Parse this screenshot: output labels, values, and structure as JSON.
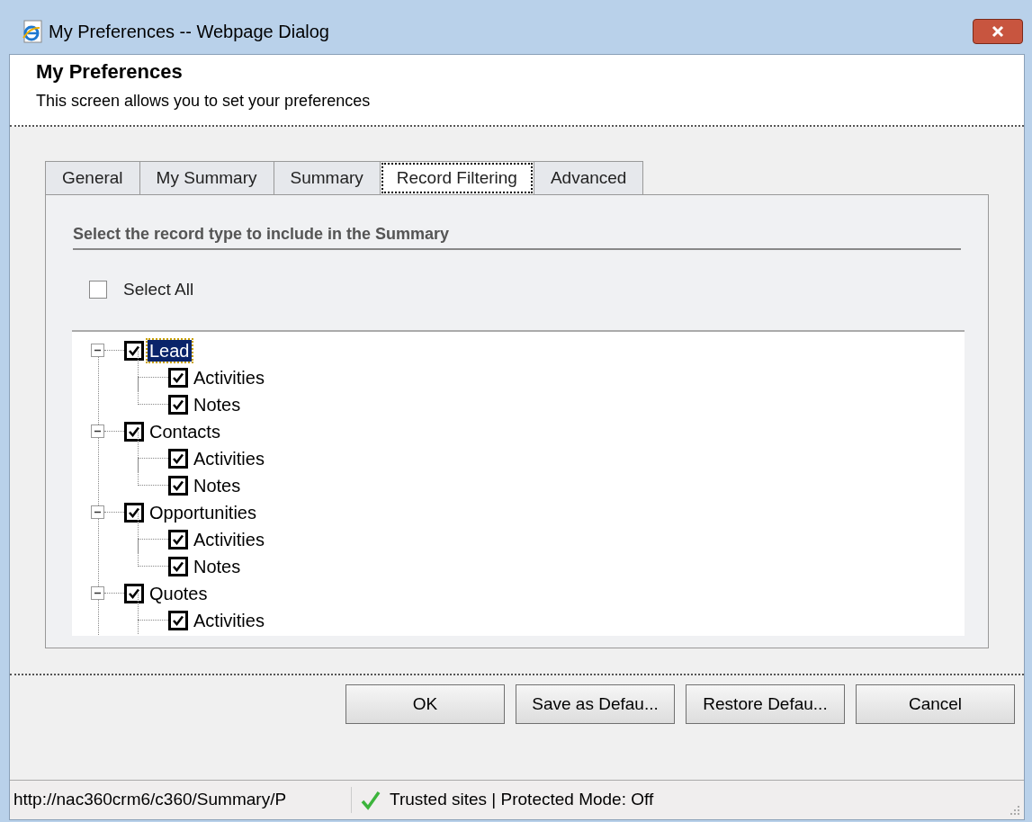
{
  "window": {
    "title": "My Preferences -- Webpage Dialog"
  },
  "header": {
    "title": "My Preferences",
    "subtitle": "This screen allows you to set your preferences"
  },
  "tabs": [
    {
      "label": "General",
      "selected": false
    },
    {
      "label": "My Summary",
      "selected": false
    },
    {
      "label": "Summary",
      "selected": false
    },
    {
      "label": "Record Filtering",
      "selected": true
    },
    {
      "label": "Advanced",
      "selected": false
    }
  ],
  "section_heading": "Select the record type to include in the Summary",
  "select_all": {
    "label": "Select All",
    "checked": false
  },
  "tree": [
    {
      "label": "Lead",
      "checked": true,
      "expanded": true,
      "selected": true,
      "children": [
        {
          "label": "Activities",
          "checked": true,
          "selected": false
        },
        {
          "label": "Notes",
          "checked": true,
          "selected": false
        }
      ]
    },
    {
      "label": "Contacts",
      "checked": true,
      "expanded": true,
      "selected": false,
      "children": [
        {
          "label": "Activities",
          "checked": true,
          "selected": false
        },
        {
          "label": "Notes",
          "checked": true,
          "selected": false
        }
      ]
    },
    {
      "label": "Opportunities",
      "checked": true,
      "expanded": true,
      "selected": false,
      "children": [
        {
          "label": "Activities",
          "checked": true,
          "selected": false
        },
        {
          "label": "Notes",
          "checked": true,
          "selected": false
        }
      ]
    },
    {
      "label": "Quotes",
      "checked": true,
      "expanded": true,
      "selected": false,
      "children": [
        {
          "label": "Activities",
          "checked": true,
          "selected": false
        }
      ]
    }
  ],
  "buttons": [
    "OK",
    "Save as Defau...",
    "Restore Defau...",
    "Cancel"
  ],
  "status_bar": {
    "url": "http://nac360crm6/c360/Summary/P",
    "zone": "Trusted sites | Protected Mode: Off"
  }
}
